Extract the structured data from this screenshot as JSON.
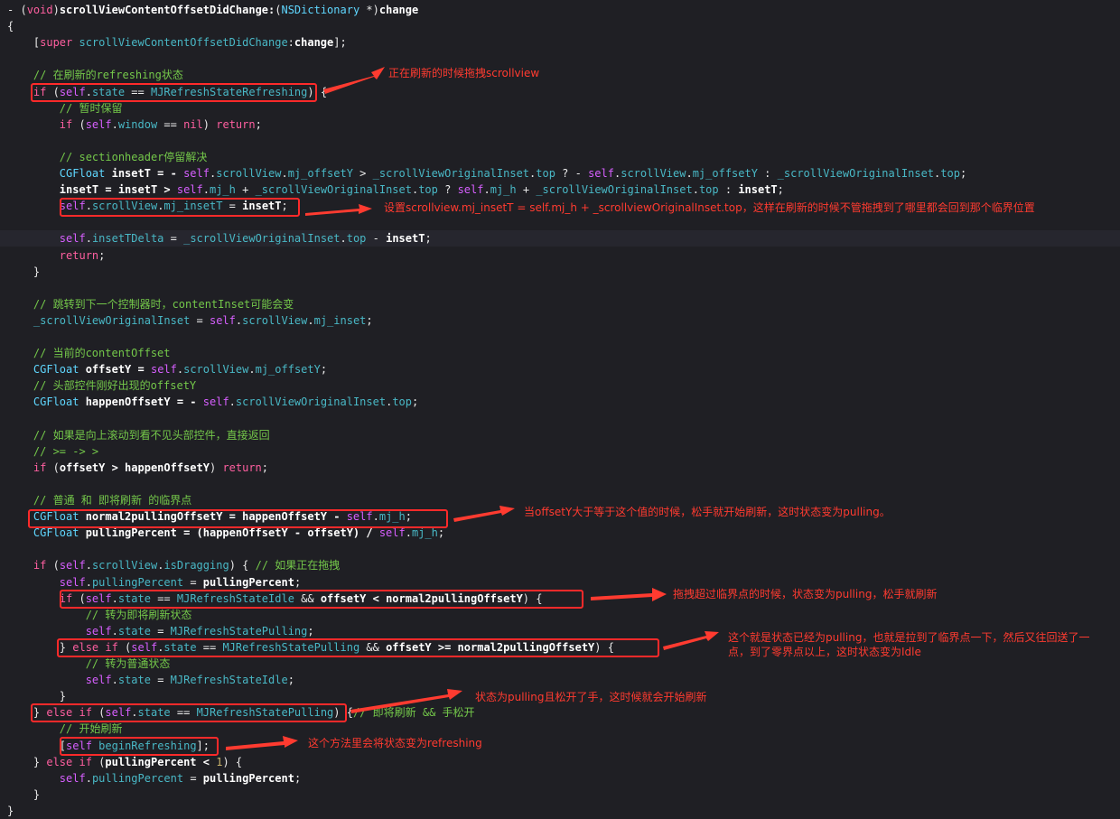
{
  "code": {
    "highlighted_line_index": 14,
    "lines": [
      [
        [
          "- (",
          "plain"
        ],
        [
          "void",
          "kw"
        ],
        [
          ")",
          "plain"
        ],
        [
          "scrollViewContentOffsetDidChange:",
          "bold"
        ],
        [
          "(",
          "plain"
        ],
        [
          "NSDictionary",
          "type"
        ],
        [
          " *)",
          "plain"
        ],
        [
          "change",
          "bold"
        ]
      ],
      [
        [
          "{",
          "plain"
        ]
      ],
      [
        [
          "    [",
          "plain"
        ],
        [
          "super",
          "kw"
        ],
        [
          " ",
          "plain"
        ],
        [
          "scrollViewContentOffsetDidChange",
          "prop"
        ],
        [
          ":",
          "plain"
        ],
        [
          "change",
          "bold"
        ],
        [
          "];",
          "plain"
        ]
      ],
      [
        [
          "",
          "plain"
        ]
      ],
      [
        [
          "    ",
          "plain"
        ],
        [
          "// 在刷新的refreshing状态",
          "cmt"
        ]
      ],
      [
        [
          "    ",
          "plain"
        ],
        [
          "if",
          "kw"
        ],
        [
          " (",
          "plain"
        ],
        [
          "self",
          "self"
        ],
        [
          ".",
          "plain"
        ],
        [
          "state",
          "prop"
        ],
        [
          " == ",
          "plain"
        ],
        [
          "MJRefreshStateRefreshing",
          "prop"
        ],
        [
          ") {",
          "plain"
        ]
      ],
      [
        [
          "        ",
          "plain"
        ],
        [
          "// 暂时保留",
          "cmt"
        ]
      ],
      [
        [
          "        ",
          "plain"
        ],
        [
          "if",
          "kw"
        ],
        [
          " (",
          "plain"
        ],
        [
          "self",
          "self"
        ],
        [
          ".",
          "plain"
        ],
        [
          "window",
          "prop"
        ],
        [
          " == ",
          "plain"
        ],
        [
          "nil",
          "kw"
        ],
        [
          ") ",
          "plain"
        ],
        [
          "return",
          "kw"
        ],
        [
          ";",
          "plain"
        ]
      ],
      [
        [
          "",
          "plain"
        ]
      ],
      [
        [
          "        ",
          "plain"
        ],
        [
          "// sectionheader停留解决",
          "cmt"
        ]
      ],
      [
        [
          "        ",
          "plain"
        ],
        [
          "CGFloat",
          "type"
        ],
        [
          " insetT = - ",
          "bold"
        ],
        [
          "self",
          "self"
        ],
        [
          ".",
          "plain"
        ],
        [
          "scrollView",
          "prop"
        ],
        [
          ".",
          "plain"
        ],
        [
          "mj_offsetY",
          "prop"
        ],
        [
          " > ",
          "plain"
        ],
        [
          "_scrollViewOriginalInset",
          "ivar"
        ],
        [
          ".",
          "plain"
        ],
        [
          "top",
          "prop"
        ],
        [
          " ? - ",
          "plain"
        ],
        [
          "self",
          "self"
        ],
        [
          ".",
          "plain"
        ],
        [
          "scrollView",
          "prop"
        ],
        [
          ".",
          "plain"
        ],
        [
          "mj_offsetY",
          "prop"
        ],
        [
          " : ",
          "plain"
        ],
        [
          "_scrollViewOriginalInset",
          "ivar"
        ],
        [
          ".",
          "plain"
        ],
        [
          "top",
          "prop"
        ],
        [
          ";",
          "plain"
        ]
      ],
      [
        [
          "        ",
          "plain"
        ],
        [
          "insetT = insetT > ",
          "bold"
        ],
        [
          "self",
          "self"
        ],
        [
          ".",
          "plain"
        ],
        [
          "mj_h",
          "prop"
        ],
        [
          " + ",
          "plain"
        ],
        [
          "_scrollViewOriginalInset",
          "ivar"
        ],
        [
          ".",
          "plain"
        ],
        [
          "top",
          "prop"
        ],
        [
          " ? ",
          "plain"
        ],
        [
          "self",
          "self"
        ],
        [
          ".",
          "plain"
        ],
        [
          "mj_h",
          "prop"
        ],
        [
          " + ",
          "plain"
        ],
        [
          "_scrollViewOriginalInset",
          "ivar"
        ],
        [
          ".",
          "plain"
        ],
        [
          "top",
          "prop"
        ],
        [
          " : ",
          "plain"
        ],
        [
          "insetT",
          "bold"
        ],
        [
          ";",
          "plain"
        ]
      ],
      [
        [
          "        ",
          "plain"
        ],
        [
          "self",
          "self"
        ],
        [
          ".",
          "plain"
        ],
        [
          "scrollView",
          "prop"
        ],
        [
          ".",
          "plain"
        ],
        [
          "mj_insetT",
          "prop"
        ],
        [
          " = ",
          "plain"
        ],
        [
          "insetT",
          "bold"
        ],
        [
          ";",
          "plain"
        ]
      ],
      [
        [
          "",
          "plain"
        ]
      ],
      [
        [
          "        ",
          "plain"
        ],
        [
          "self",
          "self"
        ],
        [
          ".",
          "plain"
        ],
        [
          "insetTDelta",
          "prop"
        ],
        [
          " = ",
          "plain"
        ],
        [
          "_scrollViewOriginalInset",
          "ivar"
        ],
        [
          ".",
          "plain"
        ],
        [
          "top",
          "prop"
        ],
        [
          " - ",
          "plain"
        ],
        [
          "insetT",
          "bold"
        ],
        [
          ";",
          "plain"
        ]
      ],
      [
        [
          "        ",
          "plain"
        ],
        [
          "return",
          "kw"
        ],
        [
          ";",
          "plain"
        ]
      ],
      [
        [
          "    }",
          "plain"
        ]
      ],
      [
        [
          "",
          "plain"
        ]
      ],
      [
        [
          "    ",
          "plain"
        ],
        [
          "// 跳转到下一个控制器时，contentInset可能会变",
          "cmt"
        ]
      ],
      [
        [
          "    ",
          "plain"
        ],
        [
          "_scrollViewOriginalInset",
          "ivar"
        ],
        [
          " = ",
          "plain"
        ],
        [
          "self",
          "self"
        ],
        [
          ".",
          "plain"
        ],
        [
          "scrollView",
          "prop"
        ],
        [
          ".",
          "plain"
        ],
        [
          "mj_inset",
          "prop"
        ],
        [
          ";",
          "plain"
        ]
      ],
      [
        [
          "",
          "plain"
        ]
      ],
      [
        [
          "    ",
          "plain"
        ],
        [
          "// 当前的contentOffset",
          "cmt"
        ]
      ],
      [
        [
          "    ",
          "plain"
        ],
        [
          "CGFloat",
          "type"
        ],
        [
          " offsetY = ",
          "bold"
        ],
        [
          "self",
          "self"
        ],
        [
          ".",
          "plain"
        ],
        [
          "scrollView",
          "prop"
        ],
        [
          ".",
          "plain"
        ],
        [
          "mj_offsetY",
          "prop"
        ],
        [
          ";",
          "plain"
        ]
      ],
      [
        [
          "    ",
          "plain"
        ],
        [
          "// 头部控件刚好出现的offsetY",
          "cmt"
        ]
      ],
      [
        [
          "    ",
          "plain"
        ],
        [
          "CGFloat",
          "type"
        ],
        [
          " happenOffsetY = - ",
          "bold"
        ],
        [
          "self",
          "self"
        ],
        [
          ".",
          "plain"
        ],
        [
          "scrollViewOriginalInset",
          "prop"
        ],
        [
          ".",
          "plain"
        ],
        [
          "top",
          "prop"
        ],
        [
          ";",
          "plain"
        ]
      ],
      [
        [
          "",
          "plain"
        ]
      ],
      [
        [
          "    ",
          "plain"
        ],
        [
          "// 如果是向上滚动到看不见头部控件，直接返回",
          "cmt"
        ]
      ],
      [
        [
          "    ",
          "plain"
        ],
        [
          "// >= -> >",
          "cmt"
        ]
      ],
      [
        [
          "    ",
          "plain"
        ],
        [
          "if",
          "kw"
        ],
        [
          " (",
          "plain"
        ],
        [
          "offsetY > happenOffsetY",
          "bold"
        ],
        [
          ") ",
          "plain"
        ],
        [
          "return",
          "kw"
        ],
        [
          ";",
          "plain"
        ]
      ],
      [
        [
          "",
          "plain"
        ]
      ],
      [
        [
          "    ",
          "plain"
        ],
        [
          "// 普通 和 即将刷新 的临界点",
          "cmt"
        ]
      ],
      [
        [
          "    ",
          "plain"
        ],
        [
          "CGFloat",
          "type"
        ],
        [
          " normal2pullingOffsetY = happenOffsetY - ",
          "bold"
        ],
        [
          "self",
          "self"
        ],
        [
          ".",
          "plain"
        ],
        [
          "mj_h",
          "prop"
        ],
        [
          ";",
          "plain"
        ]
      ],
      [
        [
          "    ",
          "plain"
        ],
        [
          "CGFloat",
          "type"
        ],
        [
          " pullingPercent = (happenOffsetY - offsetY) / ",
          "bold"
        ],
        [
          "self",
          "self"
        ],
        [
          ".",
          "plain"
        ],
        [
          "mj_h",
          "prop"
        ],
        [
          ";",
          "plain"
        ]
      ],
      [
        [
          "",
          "plain"
        ]
      ],
      [
        [
          "    ",
          "plain"
        ],
        [
          "if",
          "kw"
        ],
        [
          " (",
          "plain"
        ],
        [
          "self",
          "self"
        ],
        [
          ".",
          "plain"
        ],
        [
          "scrollView",
          "prop"
        ],
        [
          ".",
          "plain"
        ],
        [
          "isDragging",
          "prop"
        ],
        [
          ") { ",
          "plain"
        ],
        [
          "// 如果正在拖拽",
          "cmt"
        ]
      ],
      [
        [
          "        ",
          "plain"
        ],
        [
          "self",
          "self"
        ],
        [
          ".",
          "plain"
        ],
        [
          "pullingPercent",
          "prop"
        ],
        [
          " = ",
          "plain"
        ],
        [
          "pullingPercent",
          "bold"
        ],
        [
          ";",
          "plain"
        ]
      ],
      [
        [
          "        ",
          "plain"
        ],
        [
          "if",
          "kw"
        ],
        [
          " (",
          "plain"
        ],
        [
          "self",
          "self"
        ],
        [
          ".",
          "plain"
        ],
        [
          "state",
          "prop"
        ],
        [
          " == ",
          "plain"
        ],
        [
          "MJRefreshStateIdle",
          "prop"
        ],
        [
          " && ",
          "plain"
        ],
        [
          "offsetY < normal2pullingOffsetY",
          "bold"
        ],
        [
          ") {",
          "plain"
        ]
      ],
      [
        [
          "            ",
          "plain"
        ],
        [
          "// 转为即将刷新状态",
          "cmt"
        ]
      ],
      [
        [
          "            ",
          "plain"
        ],
        [
          "self",
          "self"
        ],
        [
          ".",
          "plain"
        ],
        [
          "state",
          "prop"
        ],
        [
          " = ",
          "plain"
        ],
        [
          "MJRefreshStatePulling",
          "prop"
        ],
        [
          ";",
          "plain"
        ]
      ],
      [
        [
          "        } ",
          "plain"
        ],
        [
          "else if",
          "kw"
        ],
        [
          " (",
          "plain"
        ],
        [
          "self",
          "self"
        ],
        [
          ".",
          "plain"
        ],
        [
          "state",
          "prop"
        ],
        [
          " == ",
          "plain"
        ],
        [
          "MJRefreshStatePulling",
          "prop"
        ],
        [
          " && ",
          "plain"
        ],
        [
          "offsetY >= normal2pullingOffsetY",
          "bold"
        ],
        [
          ") {",
          "plain"
        ]
      ],
      [
        [
          "            ",
          "plain"
        ],
        [
          "// 转为普通状态",
          "cmt"
        ]
      ],
      [
        [
          "            ",
          "plain"
        ],
        [
          "self",
          "self"
        ],
        [
          ".",
          "plain"
        ],
        [
          "state",
          "prop"
        ],
        [
          " = ",
          "plain"
        ],
        [
          "MJRefreshStateIdle",
          "prop"
        ],
        [
          ";",
          "plain"
        ]
      ],
      [
        [
          "        }",
          "plain"
        ]
      ],
      [
        [
          "    } ",
          "plain"
        ],
        [
          "else if",
          "kw"
        ],
        [
          " (",
          "plain"
        ],
        [
          "self",
          "self"
        ],
        [
          ".",
          "plain"
        ],
        [
          "state",
          "prop"
        ],
        [
          " == ",
          "plain"
        ],
        [
          "MJRefreshStatePulling",
          "prop"
        ],
        [
          ") {",
          "plain"
        ],
        [
          "// 即将刷新 && 手松开",
          "cmt"
        ]
      ],
      [
        [
          "        ",
          "plain"
        ],
        [
          "// 开始刷新",
          "cmt"
        ]
      ],
      [
        [
          "        [",
          "plain"
        ],
        [
          "self",
          "self"
        ],
        [
          " ",
          "plain"
        ],
        [
          "beginRefreshing",
          "prop"
        ],
        [
          "];",
          "plain"
        ]
      ],
      [
        [
          "    } ",
          "plain"
        ],
        [
          "else if",
          "kw"
        ],
        [
          " (",
          "plain"
        ],
        [
          "pullingPercent < ",
          "bold"
        ],
        [
          "1",
          "num"
        ],
        [
          ") {",
          "plain"
        ]
      ],
      [
        [
          "        ",
          "plain"
        ],
        [
          "self",
          "self"
        ],
        [
          ".",
          "plain"
        ],
        [
          "pullingPercent",
          "prop"
        ],
        [
          " = ",
          "plain"
        ],
        [
          "pullingPercent",
          "bold"
        ],
        [
          ";",
          "plain"
        ]
      ],
      [
        [
          "    }",
          "plain"
        ]
      ],
      [
        [
          "}",
          "plain"
        ]
      ]
    ]
  },
  "annotations": [
    {
      "text": "正在刷新的时候拖拽scrollview"
    },
    {
      "text": "设置scrollview.mj_insetT = self.mj_h + _scrollviewOriginalInset.top，这样在刷新的时候不管拖拽到了哪里都会回到那个临界位置"
    },
    {
      "text": "当offsetY大于等于这个值的时候，松手就开始刷新，这时状态变为pulling。"
    },
    {
      "text": "拖拽超过临界点的时候，状态变为pulling，松手就刷新"
    },
    {
      "text": "这个就是状态已经为pulling，也就是拉到了临界点一下，然后又往回送了一点，到了零界点以上，这时状态变为Idle"
    },
    {
      "text": "状态为pulling且松开了手，这时候就会开始刷新"
    },
    {
      "text": "这个方法里会将状态变为refreshing"
    }
  ],
  "colors": {
    "background": "#1f1f24",
    "highlight_line": "#26262e",
    "keyword": "#ff5fa0",
    "self": "#d75fff",
    "type": "#5fd7ff",
    "property": "#49b8c6",
    "comment": "#74c84a",
    "annotation": "#ff3b30"
  }
}
